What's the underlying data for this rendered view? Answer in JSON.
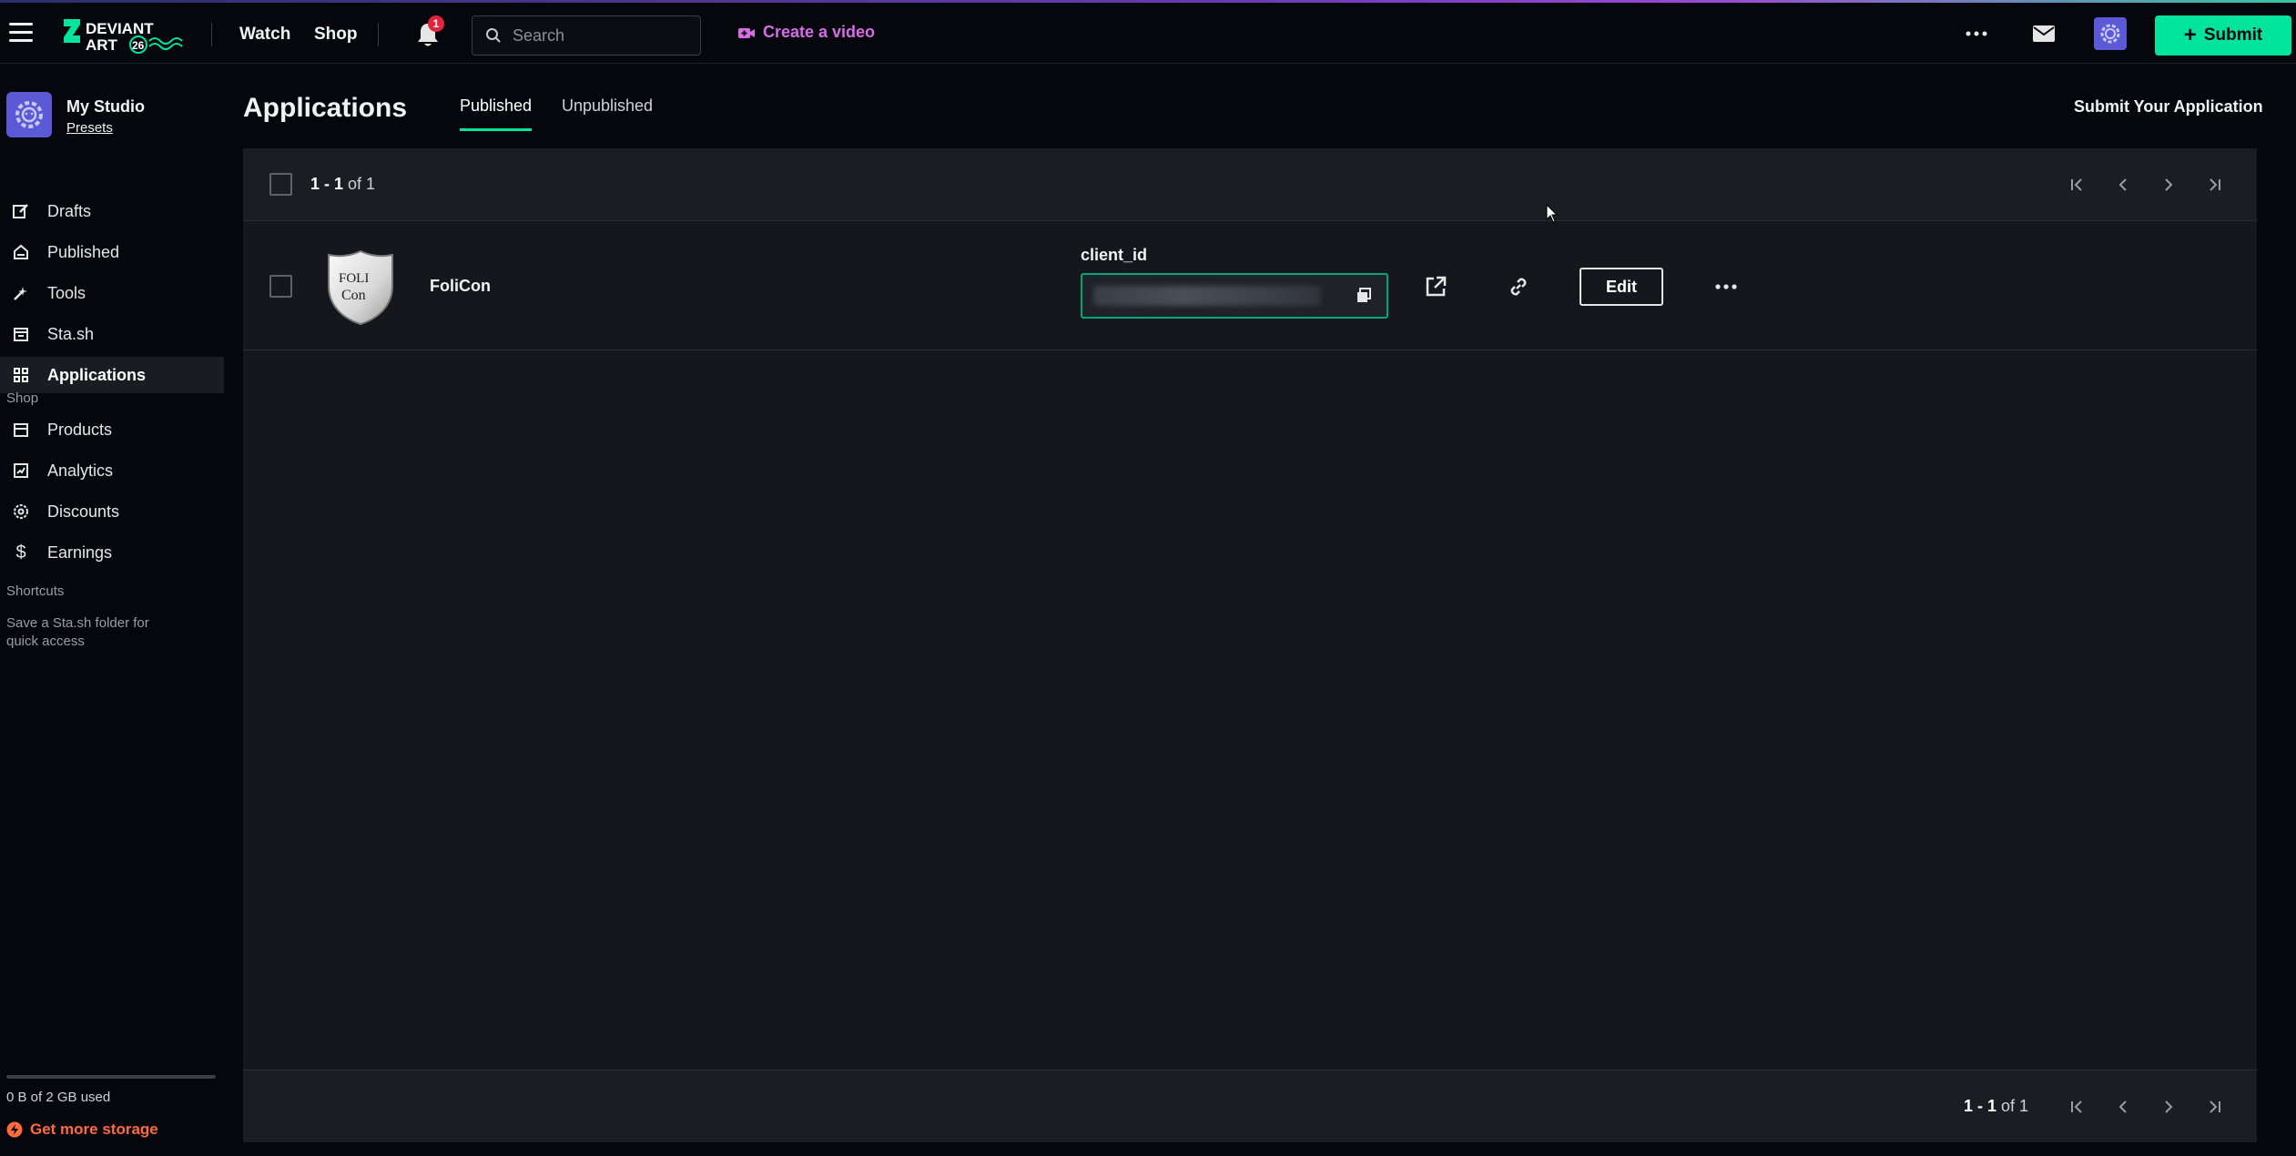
{
  "header": {
    "nav": [
      "Watch",
      "Shop"
    ],
    "notification_count": "1",
    "search_placeholder": "Search",
    "create_video": "Create a video",
    "submit": "Submit"
  },
  "sidebar": {
    "studio_name": "My Studio",
    "studio_presets": "Presets",
    "items": [
      {
        "label": "Drafts",
        "icon": "pencil-icon"
      },
      {
        "label": "Published",
        "icon": "published-icon"
      },
      {
        "label": "Tools",
        "icon": "tools-icon"
      },
      {
        "label": "Sta.sh",
        "icon": "stash-icon"
      },
      {
        "label": "Applications",
        "icon": "grid-icon",
        "active": true
      }
    ],
    "shop_heading": "Shop",
    "shop_items": [
      {
        "label": "Products",
        "icon": "store-icon"
      },
      {
        "label": "Analytics",
        "icon": "analytics-icon"
      },
      {
        "label": "Discounts",
        "icon": "discount-icon"
      },
      {
        "label": "Earnings",
        "icon": "dollar-icon"
      }
    ],
    "shortcuts_heading": "Shortcuts",
    "shortcuts_hint": "Save a Sta.sh folder for quick access",
    "storage_used": "0 B of 2 GB used",
    "storage_fraction": 0,
    "get_more_storage": "Get more storage"
  },
  "main": {
    "title": "Applications",
    "tabs": [
      {
        "label": "Published",
        "active": true
      },
      {
        "label": "Unpublished",
        "active": false
      }
    ],
    "submit_application": "Submit Your Application",
    "count_range": "1 - 1",
    "count_of": "of 1",
    "applications": [
      {
        "name": "FoliCon",
        "logo_text_top": "FOLI",
        "logo_text_bottom": "Con",
        "client_id_label": "client_id",
        "edit_label": "Edit"
      }
    ]
  },
  "colors": {
    "accent": "#00e59b",
    "brand_purple": "#5b59d6",
    "create_video": "#d86ce6",
    "storage_cta": "#ff6a3d",
    "badge": "#e0263f"
  }
}
